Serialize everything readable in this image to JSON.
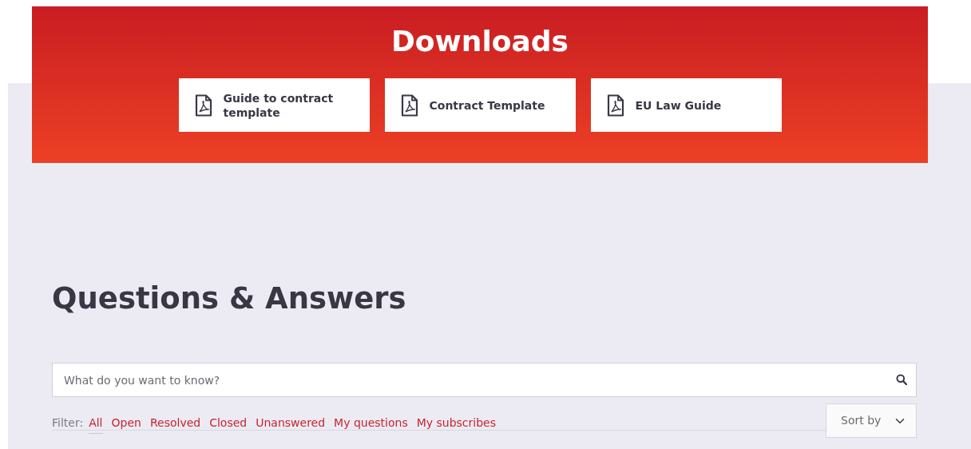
{
  "downloads": {
    "title": "Downloads",
    "items": [
      {
        "label": "Guide to contract template"
      },
      {
        "label": "Contract Template"
      },
      {
        "label": "EU Law Guide"
      }
    ]
  },
  "qa": {
    "title": "Questions & Answers",
    "search": {
      "placeholder": "What do you want to know?"
    },
    "filter_label": "Filter:",
    "filters": [
      {
        "label": "All",
        "selected": true
      },
      {
        "label": "Open",
        "selected": false
      },
      {
        "label": "Resolved",
        "selected": false
      },
      {
        "label": "Closed",
        "selected": false
      },
      {
        "label": "Unanswered",
        "selected": false
      },
      {
        "label": "My questions",
        "selected": false
      },
      {
        "label": "My subscribes",
        "selected": false
      }
    ],
    "sort": {
      "placeholder": "Sort by"
    }
  }
}
